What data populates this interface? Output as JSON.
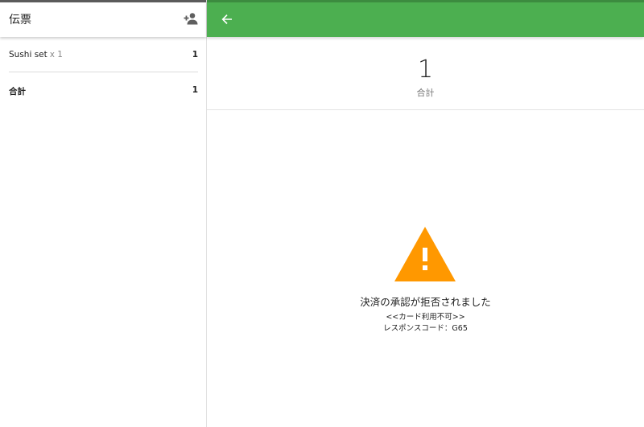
{
  "sidebar": {
    "title": "伝票",
    "add_person_icon": "person-add-icon",
    "items": [
      {
        "name": "Sushi set",
        "qty": "x 1",
        "amount": "1"
      }
    ],
    "total": {
      "label": "合計",
      "amount": "1"
    }
  },
  "topbar": {
    "back_icon": "arrow-back-icon",
    "color": "#4caf50"
  },
  "summary": {
    "amount": "1",
    "label": "合計"
  },
  "error": {
    "icon": "warning-icon",
    "icon_color": "#ff9800",
    "message": "決済の承認が拒否されました",
    "detail": "<<カード利用不可>>",
    "code": "レスポンスコード：G65"
  }
}
